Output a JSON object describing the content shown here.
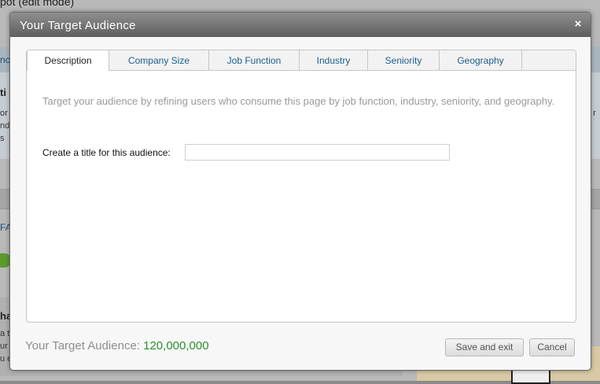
{
  "background": {
    "page_title": "pot (edit mode)",
    "band_text": "nc",
    "panel_heading": "ti",
    "panel_left_lines": [
      "or",
      "nd",
      "s"
    ],
    "panel_right_lines": [
      "o r",
      "e"
    ],
    "fa_text": "FA",
    "panel2_heading": "ha",
    "panel2_lines": [
      "a t",
      "ur",
      "u ex"
    ]
  },
  "dialog": {
    "title": "Your Target Audience",
    "close_glyph": "×",
    "tabs": [
      {
        "label": "Description",
        "active": true
      },
      {
        "label": "Company Size",
        "active": false
      },
      {
        "label": "Job Function",
        "active": false
      },
      {
        "label": "Industry",
        "active": false
      },
      {
        "label": "Seniority",
        "active": false
      },
      {
        "label": "Geography",
        "active": false
      }
    ],
    "description": {
      "hint": "Target your audience by refining users who consume this page by job function, industry, seniority, and geography.",
      "title_field_label": "Create a title for this audience:",
      "title_field_value": ""
    },
    "footer": {
      "audience_label": "Your Target Audience:",
      "audience_count": "120,000,000",
      "save_label": "Save and exit",
      "cancel_label": "Cancel"
    }
  },
  "colors": {
    "tab_link": "#1c5f8c",
    "audience_count": "#2c8f2c",
    "titlebar": "#6e6e6e"
  }
}
